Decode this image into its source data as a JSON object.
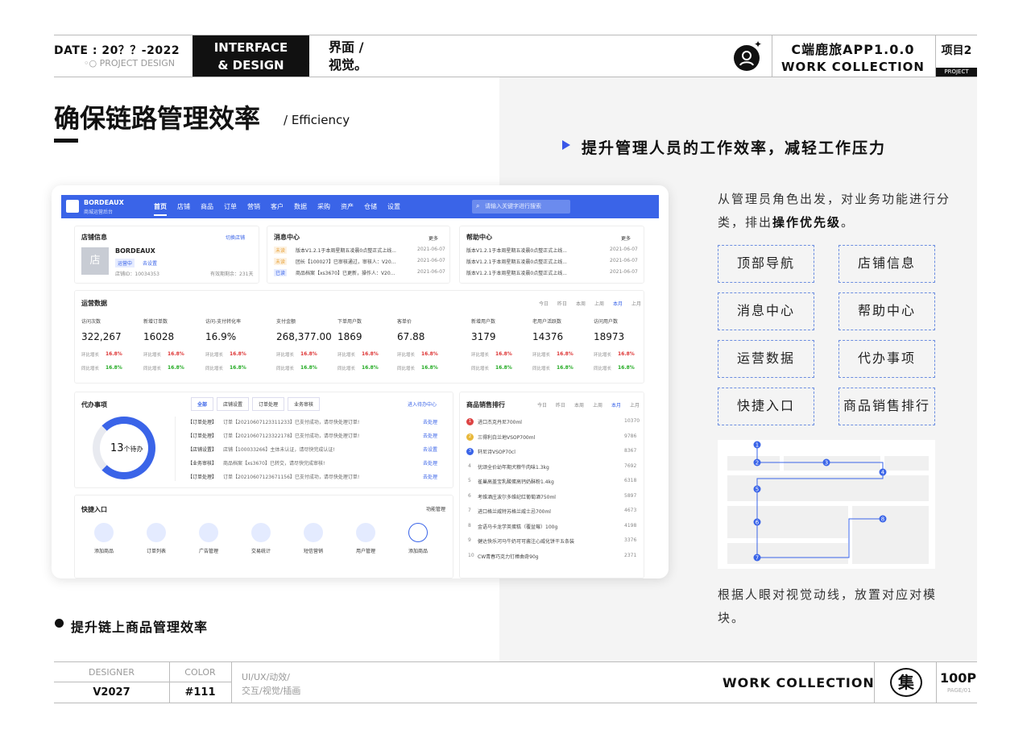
{
  "header": {
    "date": "DATE : 20？？-2022",
    "project_design": "◦○ PROJECT DESIGN",
    "interface_line1": "INTERFACE",
    "interface_line2": "& DESIGN",
    "jm_line1": "界面 /",
    "jm_line2": "视觉。",
    "app_title": "C端鹿旅APP1.0.0",
    "work_collection": "WORK  COLLECTION",
    "project_no": "项目2",
    "project_label": "PROJECT"
  },
  "page": {
    "title": "确保链路管理效率",
    "subtitle": "/ Efficiency",
    "right_title": "提升管理人员的工作效率，减轻工作压力",
    "desc_part1": "从管理员角色出发，对业务功能进行分类，排出",
    "desc_bold": "操作优先级",
    "desc_part2": "。",
    "modules": [
      "顶部导航",
      "店铺信息",
      "消息中心",
      "帮助中心",
      "运营数据",
      "代办事项",
      "快捷入口",
      "商品销售排行"
    ],
    "caption": "根据人眼对视觉动线，放置对应对模块。",
    "bottom_text": "提升链上商品管理效率",
    "flow_points": [
      "1",
      "2",
      "3",
      "4",
      "5",
      "6",
      "7",
      "8"
    ]
  },
  "footer": {
    "designer_label": "DESIGNER",
    "designer_value": "V2027",
    "color_label": "COLOR",
    "color_value": "#111",
    "tags_line1": "UI/UX/动效/",
    "tags_line2": "交互/视觉/插画",
    "work_collection": "WORK  COLLECTION",
    "logo_char": "集",
    "pages": "100P",
    "page_no": "PAGE/01"
  },
  "dashboard": {
    "brand": "BORDEAUX",
    "brand_sub": "商城运营后台",
    "nav": [
      "首页",
      "店铺",
      "商品",
      "订单",
      "营销",
      "客户",
      "数据",
      "采购",
      "资产",
      "仓储",
      "设置"
    ],
    "search_placeholder": "请输入关键字进行搜索",
    "shop": {
      "title": "店铺信息",
      "switch": "切换店铺",
      "avatar": "店",
      "name": "BORDEAUX",
      "status": "运营中",
      "setup": "去设置",
      "id": "店铺ID：10034353",
      "valid": "有效期剩余：231天"
    },
    "messages": {
      "title": "消息中心",
      "more": "更多",
      "items": [
        {
          "tag": "未读",
          "text": "版本V1.2.1于本周星期五凌晨0点整正式上线...",
          "date": "2021-06-07"
        },
        {
          "tag": "未读",
          "text": "团长【100027】已审核通过，审核人：V20...",
          "date": "2021-06-07"
        },
        {
          "tag": "已读",
          "text": "商品档案【xs3670】已更新，操作人：V20...",
          "date": "2021-06-07"
        }
      ]
    },
    "help": {
      "title": "帮助中心",
      "more": "更多",
      "items": [
        {
          "text": "版本V1.2.1于本周星期五凌晨0点整正式上线...",
          "date": "2021-06-07"
        },
        {
          "text": "版本V1.2.1于本周星期五凌晨0点整正式上线...",
          "date": "2021-06-07"
        },
        {
          "text": "版本V1.2.1于本周星期五凌晨0点整正式上线...",
          "date": "2021-06-07"
        }
      ]
    },
    "ops": {
      "title": "运营数据",
      "periods": [
        "今日",
        "昨日",
        "本周",
        "上周",
        "本月",
        "上月"
      ],
      "metrics": [
        {
          "label": "访问次数",
          "value": "322,267"
        },
        {
          "label": "新增订单数",
          "value": "16028"
        },
        {
          "label": "访问-支付转化率",
          "value": "16.9%"
        },
        {
          "label": "支付金额",
          "value": "268,377.00"
        },
        {
          "label": "下单用户数",
          "value": "1869"
        },
        {
          "label": "客单价",
          "value": "67.88"
        },
        {
          "label": "新增用户数",
          "value": "3179"
        },
        {
          "label": "老用户活跃数",
          "value": "14376"
        },
        {
          "label": "访问用户数",
          "value": "18973"
        }
      ],
      "mom_label": "环比增长",
      "yoy_label": "同比增长",
      "rate": "16.8%"
    },
    "todo": {
      "title": "代办事项",
      "tabs": [
        "全部",
        "店铺设置",
        "订单处理",
        "业务审核"
      ],
      "enter": "进入待办中心",
      "count": "13",
      "unit": "个待办",
      "items": [
        {
          "cat": "【订单处理】",
          "text": "订单【20210607123311233】已支付成功，请尽快处理订单!",
          "action": "去处理"
        },
        {
          "cat": "【订单处理】",
          "text": "订单【20210607123322178】已支付成功，请尽快处理订单!",
          "action": "去处理"
        },
        {
          "cat": "【店铺设置】",
          "text": "店铺【100033266】主体未认证，请尽快完成认证!",
          "action": "去设置"
        },
        {
          "cat": "【业务审核】",
          "text": "商品档案【xs3670】已转交，请尽快完成审核!",
          "action": "去处理"
        },
        {
          "cat": "【订单处理】",
          "text": "订单【20210607123671156】已支付成功，请尽快处理订单!",
          "action": "去处理"
        }
      ]
    },
    "quick": {
      "title": "快捷入口",
      "manage": "功能管理",
      "items": [
        "添加商品",
        "订单列表",
        "广告管理",
        "交易统计",
        "短信营销",
        "用户管理",
        "添加商品"
      ]
    },
    "ranking": {
      "title": "商品销售排行",
      "periods": [
        "今日",
        "昨日",
        "本周",
        "上周",
        "本月",
        "上月"
      ],
      "items": [
        {
          "rank": "1",
          "name": "进口杰克丹尼700ml",
          "value": "10370"
        },
        {
          "rank": "2",
          "name": "三得利白兰地VSOP700ml",
          "value": "9786"
        },
        {
          "rank": "3",
          "name": "轩尼诗VSOP70cl",
          "value": "8367"
        },
        {
          "rank": "4",
          "name": "优颂全价幼年期犬粮牛肉味1.3kg",
          "value": "7692"
        },
        {
          "rank": "5",
          "name": "雀巢高盖宝乳酸蛋高钙奶酥粉1.4kg",
          "value": "6318"
        },
        {
          "rank": "6",
          "name": "考维酒庄波尔多维纪红葡萄酒750ml",
          "value": "5897"
        },
        {
          "rank": "7",
          "name": "进口格兰威特苏格兰威士忌700ml",
          "value": "4673"
        },
        {
          "rank": "8",
          "name": "金语马卡龙学英蛋糕（覆盆莓）100g",
          "value": "4198"
        },
        {
          "rank": "9",
          "name": "健达快乐河马牛奶可可酱注心威化饼干五条装",
          "value": "3376"
        },
        {
          "rank": "10",
          "name": "CW青春巧克力钉棒曲奇90g",
          "value": "2371"
        }
      ]
    }
  },
  "colors": {
    "accent": "#3a64e8",
    "dashed": "#6b8de0",
    "dark": "#111111"
  }
}
